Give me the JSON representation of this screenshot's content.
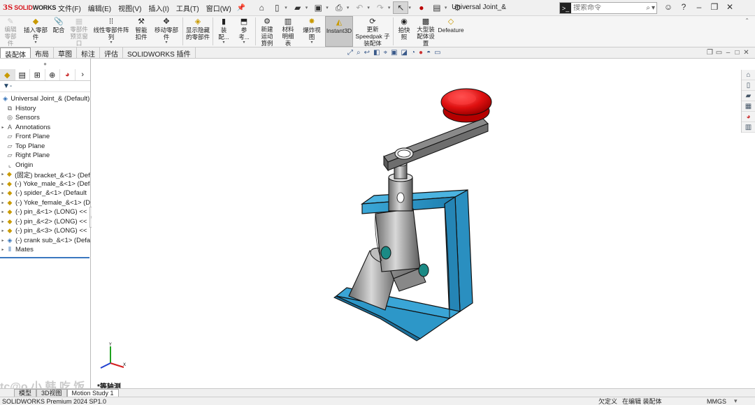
{
  "app": {
    "logo_ds": "3S",
    "logo_solid": "SOLID",
    "logo_works": "WORKS",
    "document_title": "Universal Joint_&"
  },
  "menu": [
    "文件(F)",
    "编辑(E)",
    "视图(V)",
    "插入(I)",
    "工具(T)",
    "窗口(W)"
  ],
  "search": {
    "placeholder": "搜索命令"
  },
  "command_manager": {
    "edit_component": "编辑零部件",
    "insert_component": "插入零部件",
    "mate": "配合",
    "component_preview": "零部件预览窗口",
    "linear_pattern": "线性零部件阵列",
    "smart_fasteners": "智能扣件",
    "move_component": "移动零部件",
    "show_hidden": "显示隐藏的零部件",
    "assembly": "装配...",
    "reference": "参考...",
    "new_motion_study": "新建运动算例",
    "bom": "材料明细表",
    "exploded_view": "爆炸视图",
    "instant3d": "Instant3D",
    "update_speedpak": "更新 Speedpak 子装配体",
    "snapshot": "拍快照",
    "large_assembly": "大型装配体设置",
    "defeature": "Defeature"
  },
  "tabs": [
    "装配体",
    "布局",
    "草图",
    "标注",
    "评估",
    "SOLIDWORKS 插件"
  ],
  "feature_tree": {
    "filter_label": "▼-",
    "root": "Universal Joint_& (Default) <",
    "items": [
      {
        "icon": "history-icon",
        "glyph": "⧉",
        "label": "History"
      },
      {
        "icon": "sensors-icon",
        "glyph": "◎",
        "label": "Sensors"
      },
      {
        "icon": "annotations-icon",
        "glyph": "A",
        "label": "Annotations"
      },
      {
        "icon": "front-plane-icon",
        "glyph": "▱",
        "label": "Front Plane"
      },
      {
        "icon": "top-plane-icon",
        "glyph": "▱",
        "label": "Top Plane"
      },
      {
        "icon": "right-plane-icon",
        "glyph": "▱",
        "label": "Right Plane"
      },
      {
        "icon": "origin-icon",
        "glyph": "⌞",
        "label": "Origin"
      },
      {
        "icon": "part-icon",
        "glyph": "◆",
        "label": "(固定) bracket_&<1> (Defa"
      },
      {
        "icon": "part-icon",
        "glyph": "◆",
        "label": "(-) Yoke_male_&<1> (Defa"
      },
      {
        "icon": "part-icon",
        "glyph": "◆",
        "label": "(-) spider_&<1> (Default"
      },
      {
        "icon": "part-icon",
        "glyph": "◆",
        "label": "(-) Yoke_female_&<1> (D"
      },
      {
        "icon": "part-icon",
        "glyph": "◆",
        "label": "(-) pin_&<1> (LONG) <<"
      },
      {
        "icon": "part-icon",
        "glyph": "◆",
        "label": "(-) pin_&<2> (LONG) <<"
      },
      {
        "icon": "part-icon",
        "glyph": "◆",
        "label": "(-) pin_&<3> (LONG) <<"
      },
      {
        "icon": "subassembly-icon",
        "glyph": "◈",
        "label": "(-) crank sub_&<1> (Defa"
      },
      {
        "icon": "mates-icon",
        "glyph": "⦀",
        "label": "Mates"
      }
    ]
  },
  "viewport": {
    "view_name": "*等轴测",
    "watermark": "tc@o  小 韩 吃 饭"
  },
  "bottom_tabs": [
    "模型",
    "3D视图",
    "Motion Study 1"
  ],
  "status": {
    "version": "SOLIDWORKS Premium 2024 SP1.0",
    "underdefined": "欠定义",
    "editing": "在编辑 装配体",
    "units": "MMGS",
    "more": "▾"
  },
  "colors": {
    "bracket": "#2e95c4",
    "knob": "#e11414",
    "teal_hole": "#1b8a85",
    "active_tool": "#c8c8c8"
  }
}
